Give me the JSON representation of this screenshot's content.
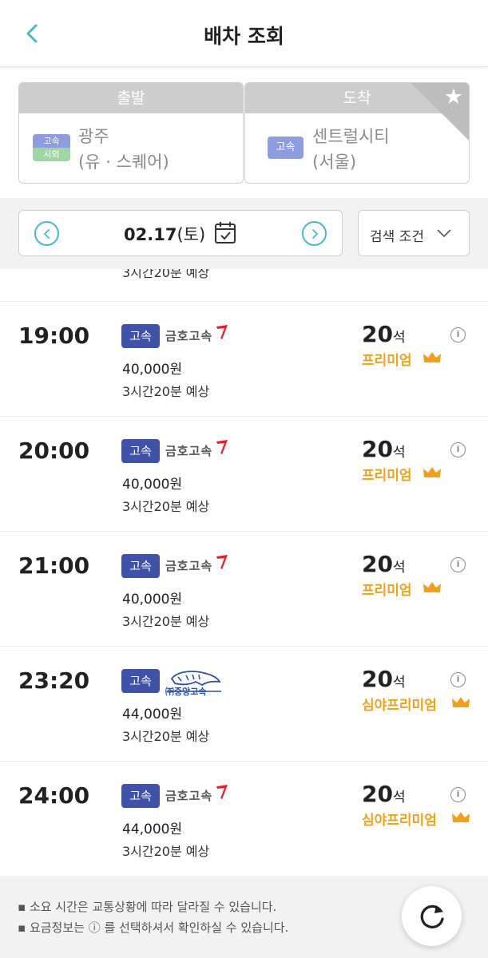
{
  "header": {
    "title": "배차 조회",
    "back_icon": "chevron-left-icon"
  },
  "route": {
    "departure": {
      "caption": "출발",
      "badge_top": "고속",
      "badge_bottom": "시외",
      "name": "광주",
      "sub": "(유 · 스퀘어)"
    },
    "arrival": {
      "caption": "도착",
      "badge": "고속",
      "name": "센트럴시티",
      "sub": "(서울)",
      "favorite_icon": "star-icon"
    }
  },
  "date_bar": {
    "date": "02.17",
    "weekday": "(토)",
    "filter_label": "검색 조건"
  },
  "partial_row": {
    "duration": "3시간20분 예상"
  },
  "rows": [
    {
      "time": "19:00",
      "class": "고속",
      "company": "금호고속",
      "price": "40,000원",
      "duration": "3시간20분 예상",
      "seats": "20",
      "seat_unit": "석",
      "grade": "프리미엄"
    },
    {
      "time": "20:00",
      "class": "고속",
      "company": "금호고속",
      "price": "40,000원",
      "duration": "3시간20분 예상",
      "seats": "20",
      "seat_unit": "석",
      "grade": "프리미엄"
    },
    {
      "time": "21:00",
      "class": "고속",
      "company": "금호고속",
      "price": "40,000원",
      "duration": "3시간20분 예상",
      "seats": "20",
      "seat_unit": "석",
      "grade": "프리미엄"
    },
    {
      "time": "23:20",
      "class": "고속",
      "company": "㈜중앙고속",
      "price": "44,000원",
      "duration": "3시간20분 예상",
      "seats": "20",
      "seat_unit": "석",
      "grade": "심야프리미엄"
    },
    {
      "time": "24:00",
      "class": "고속",
      "company": "금호고속",
      "price": "44,000원",
      "duration": "3시간20분 예상",
      "seats": "20",
      "seat_unit": "석",
      "grade": "심야프리미엄"
    }
  ],
  "footer": {
    "notes": [
      "소요 시간은 교통상황에 따라 달라질 수 있습니다.",
      "요금정보는 ⓘ 를 선택하셔서 확인하실 수 있습니다."
    ],
    "refresh_icon": "refresh-icon"
  },
  "colors": {
    "accent": "#45b9c4",
    "badge_blue": "#3f52a8",
    "premium": "#f0a01e",
    "kumho_red": "#e0202a"
  }
}
